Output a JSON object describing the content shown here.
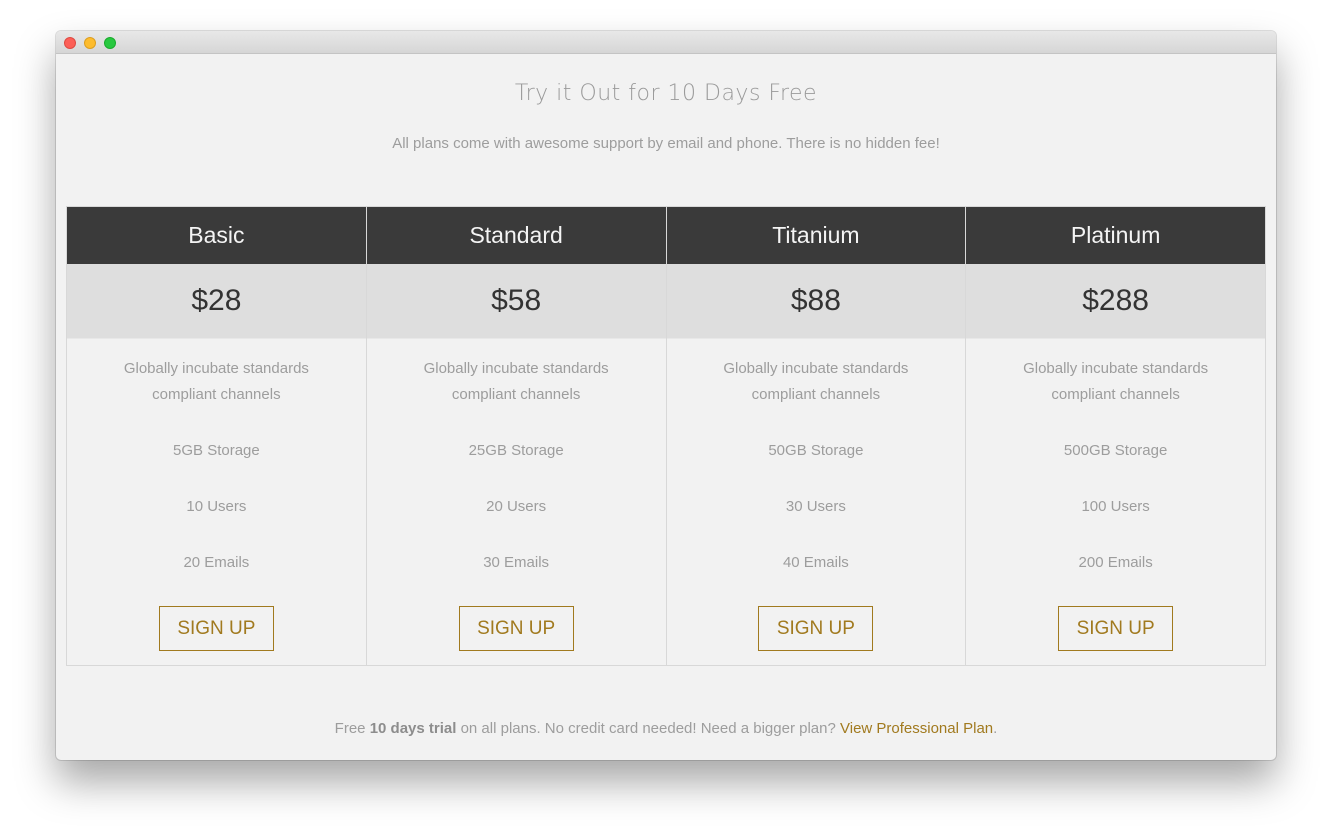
{
  "window": {
    "controls": [
      "close",
      "minimize",
      "maximize"
    ]
  },
  "header": {
    "title": "Try it Out for 10 Days Free",
    "subtitle": "All plans come with awesome support by email and phone. There is no hidden fee!"
  },
  "plans": [
    {
      "name": "Basic",
      "price": "$28",
      "description": "Globally incubate standards compliant channels",
      "storage": "5GB Storage",
      "users": "10 Users",
      "emails": "20 Emails",
      "cta": "SIGN UP"
    },
    {
      "name": "Standard",
      "price": "$58",
      "description": "Globally incubate standards compliant channels",
      "storage": "25GB Storage",
      "users": "20 Users",
      "emails": "30 Emails",
      "cta": "SIGN UP"
    },
    {
      "name": "Titanium",
      "price": "$88",
      "description": "Globally incubate standards compliant channels",
      "storage": "50GB Storage",
      "users": "30 Users",
      "emails": "40 Emails",
      "cta": "SIGN UP"
    },
    {
      "name": "Platinum",
      "price": "$288",
      "description": "Globally incubate standards compliant channels",
      "storage": "500GB Storage",
      "users": "100 Users",
      "emails": "200 Emails",
      "cta": "SIGN UP"
    }
  ],
  "footer": {
    "prefix": "Free ",
    "bold": "10 days trial",
    "middle": " on all plans. No credit card needed! Need a bigger plan? ",
    "link": "View Professional Plan",
    "suffix": "."
  },
  "colors": {
    "accent": "#a17a1f",
    "header_bg": "#3a3a3a",
    "price_bg": "#dedede",
    "page_bg": "#f2f2f2"
  }
}
